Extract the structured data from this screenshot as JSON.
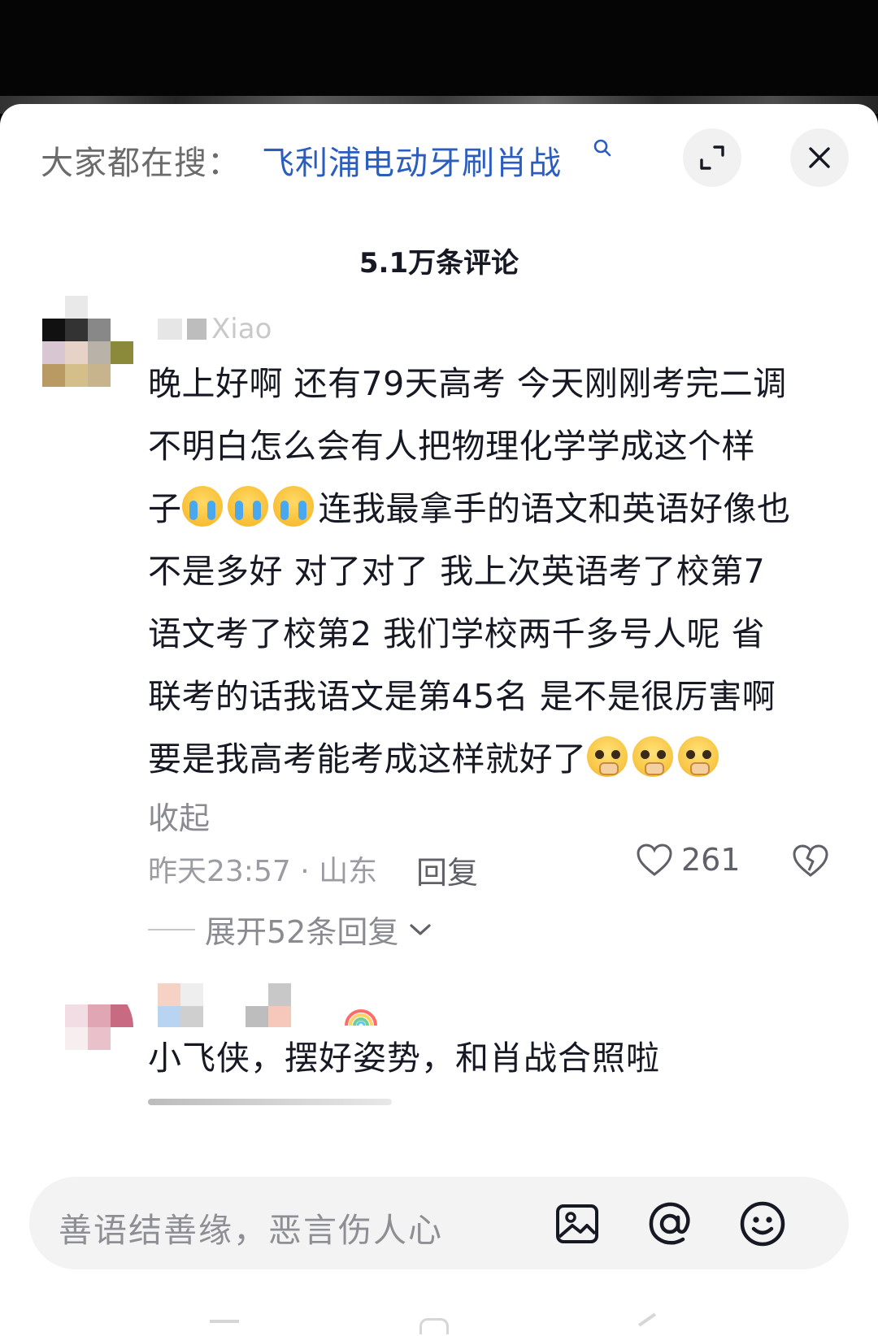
{
  "header": {
    "search_prefix": "大家都在搜：",
    "search_term": "飞利浦电动牙刷肖战",
    "search_term_icon": "search-icon",
    "expand_icon": "expand-icon",
    "close_icon": "close-icon"
  },
  "comment_count": "5.1万条评论",
  "comments": [
    {
      "username": "Xiao",
      "lines": [
        "晚上好啊 还有79天高考 今天刚刚考完二调",
        "不明白怎么会有人把物理化学学成这个样",
        "连我最拿手的语文和英语好像也",
        "不是多好 对了对了 我上次英语考了校第7",
        "语文考了校第2 我们学校两千多号人呢 省",
        "联考的话我语文是第45名 是不是很厉害啊",
        "要是我高考能考成这样就好了"
      ],
      "line3_prefix": "子",
      "emoji_cry": "loudly-crying-emoji",
      "emoji_plead": "pleading-emoji",
      "collapse_label": "收起",
      "time_location": "昨天23:57 · 山东",
      "reply_label": "回复",
      "like_count": "261",
      "expand_replies_label": "展开52条回复"
    },
    {
      "text": "小飞侠，摆好姿势，和肖战合照啦",
      "emoji": "rainbow-emoji"
    }
  ],
  "input": {
    "placeholder": "善语结善缘，恶言伤人心",
    "image_icon": "image-icon",
    "at_icon": "at-icon",
    "emoji_icon": "smiley-icon"
  },
  "colors": {
    "link_blue": "#2a5dbd",
    "text_primary": "#161823",
    "text_secondary": "#8a8b91"
  }
}
